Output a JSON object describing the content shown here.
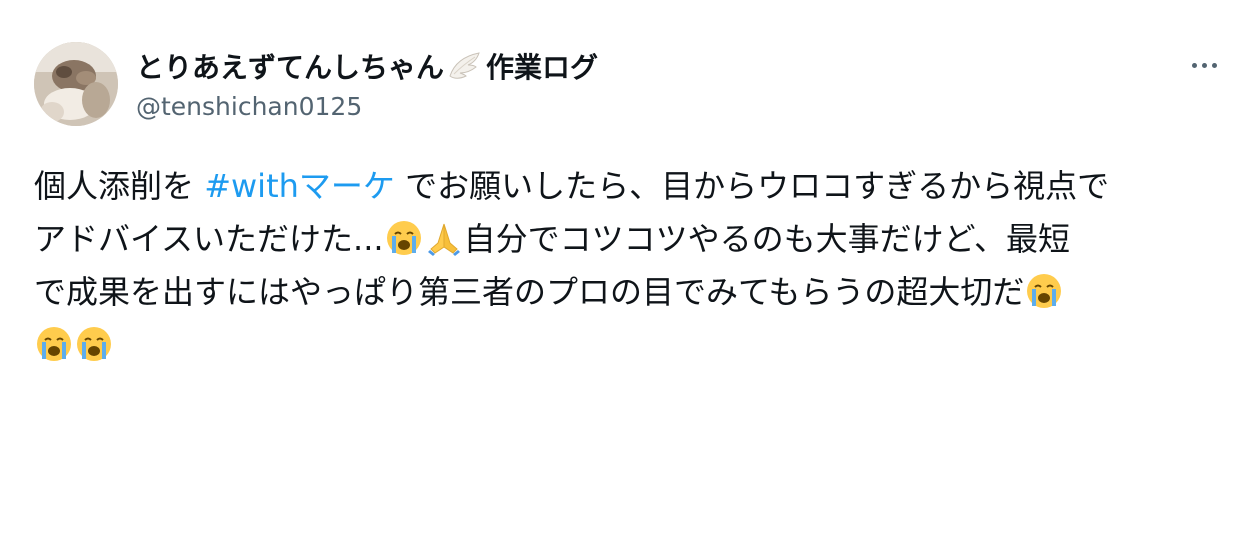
{
  "author": {
    "display_name": "とりあえずてんしちゃん",
    "display_name_emoji": "wing-icon",
    "display_name_suffix": "作業ログ",
    "handle": "@tenshichan0125"
  },
  "more_menu": {
    "icon": "more-horizontal-icon"
  },
  "tweet": {
    "line1_text": "個人添削を ",
    "hashtag": "#withマーケ",
    "line1_rest": " でお願いしたら、目からウロコすぎるから視点で",
    "line2_text": "アドバイスいただけた...",
    "emoji_crying": "loudly-crying-face-icon",
    "emoji_pray": "folded-hands-icon",
    "line2_rest": "自分でコツコツやるのも大事だけど、最短",
    "line3_text": "で成果を出すにはやっぱり第三者のプロの目でみてもらうの超大切だ"
  },
  "colors": {
    "text": "#0f1419",
    "secondary": "#536471",
    "link": "#1d9bf0",
    "background": "#ffffff"
  }
}
